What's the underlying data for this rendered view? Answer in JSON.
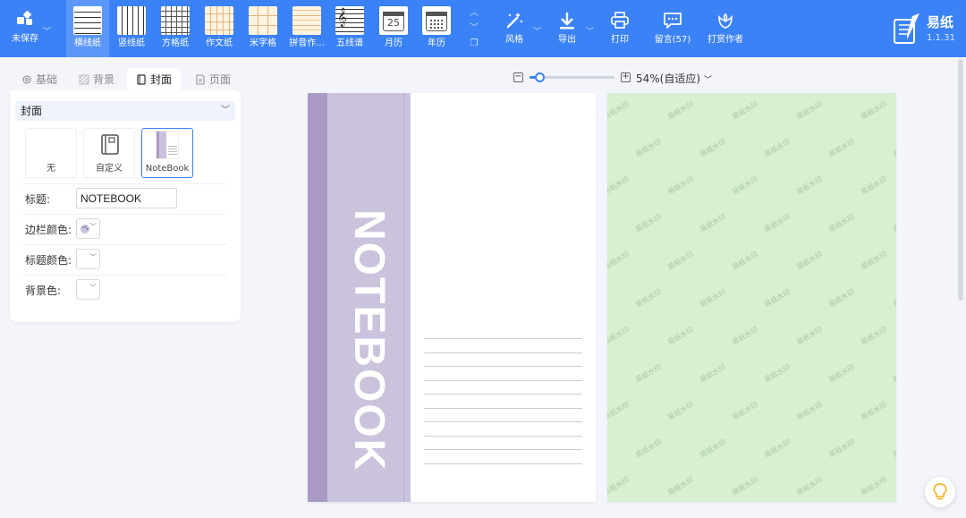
{
  "app": {
    "name": "易纸",
    "version": "1.1.31"
  },
  "toolbar": {
    "save_label": "未保存",
    "paper_types": [
      {
        "label": "横线纸",
        "icon": "horizontal-lines-thumb",
        "active": true
      },
      {
        "label": "竖线纸",
        "icon": "vertical-lines-thumb"
      },
      {
        "label": "方格纸",
        "icon": "grid-thumb"
      },
      {
        "label": "作文纸",
        "icon": "composition-thumb"
      },
      {
        "label": "米字格",
        "icon": "mi-grid-thumb"
      },
      {
        "label": "拼音作...",
        "icon": "pinyin-thumb"
      },
      {
        "label": "五线谱",
        "icon": "staff-thumb"
      },
      {
        "label": "月历",
        "icon": "month-calendar-thumb",
        "day_number": "25"
      },
      {
        "label": "年历",
        "icon": "year-calendar-thumb"
      }
    ],
    "tools": [
      {
        "label": "风格",
        "icon": "magic-wand-icon"
      },
      {
        "label": "导出",
        "icon": "download-icon"
      },
      {
        "label": "打印",
        "icon": "printer-icon"
      },
      {
        "label": "留言(57)",
        "icon": "message-icon"
      },
      {
        "label": "打赏作者",
        "icon": "flower-icon"
      }
    ]
  },
  "left_panel": {
    "tabs": [
      {
        "label": "基础",
        "icon": "gear-icon"
      },
      {
        "label": "背景",
        "icon": "texture-icon"
      },
      {
        "label": "封面",
        "icon": "notebook-icon",
        "active": true
      },
      {
        "label": "页面",
        "icon": "page-icon"
      }
    ],
    "section_select": "封面",
    "cover_options": [
      {
        "label": "无"
      },
      {
        "label": "自定义",
        "icon": "book-icon"
      },
      {
        "label": "NoteBook",
        "selected": true
      }
    ],
    "fields": {
      "title_label": "标题:",
      "title_value": "NOTEBOOK",
      "sidebar_color_label": "边栏颜色:",
      "title_color_label": "标题颜色:",
      "bg_color_label": "背景色:"
    }
  },
  "zoom": {
    "percent": 54,
    "label": "54%(自适应)"
  },
  "preview": {
    "cover_title": "NOTEBOOK",
    "watermark": "易纸水印"
  },
  "colors": {
    "primary": "#3b82f6",
    "spine_dark": "#a99bc4",
    "spine_light": "#cbc2dc",
    "page_green": "#d8efd2"
  }
}
